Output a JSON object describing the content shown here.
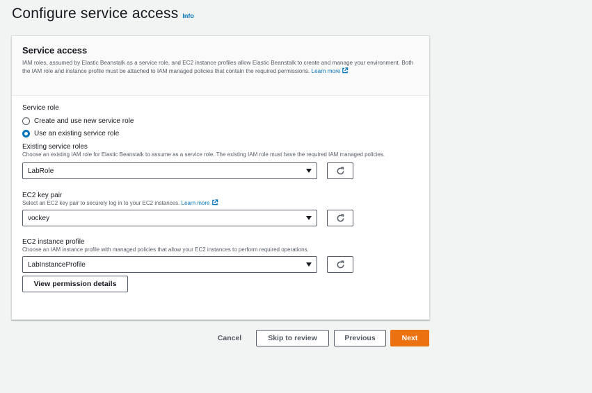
{
  "header": {
    "title": "Configure service access",
    "info_label": "Info"
  },
  "service_access": {
    "title": "Service access",
    "description": "IAM roles, assumed by Elastic Beanstalk as a service role, and EC2 instance profiles allow Elastic Beanstalk to create and manage your environment. Both the IAM role and instance profile must be attached to IAM managed policies that contain the required permissions.",
    "learn_more": "Learn more"
  },
  "service_role": {
    "label": "Service role",
    "options": [
      {
        "label": "Create and use new service role",
        "selected": false
      },
      {
        "label": "Use an existing service role",
        "selected": true
      }
    ]
  },
  "existing_roles": {
    "label": "Existing service roles",
    "description": "Choose an existing IAM role for Elastic Beanstalk to assume as a service role. The existing IAM role must have the required IAM managed policies.",
    "value": "LabRole"
  },
  "key_pair": {
    "label": "EC2 key pair",
    "description": "Select an EC2 key pair to securely log in to your EC2 instances.",
    "learn_more": "Learn more",
    "value": "vockey"
  },
  "instance_profile": {
    "label": "EC2 instance profile",
    "description": "Choose an IAM instance profile with managed policies that allow your EC2 instances to perform required operations.",
    "value": "LabInstanceProfile",
    "view_details": "View permission details"
  },
  "footer": {
    "cancel": "Cancel",
    "skip": "Skip to review",
    "previous": "Previous",
    "next": "Next"
  },
  "icons": {
    "refresh": "refresh-icon",
    "external": "external-link-icon",
    "dropdown": "caret-down-icon"
  },
  "colors": {
    "link": "#0073bb",
    "primary": "#ec7211",
    "background": "#f2f3f3"
  }
}
